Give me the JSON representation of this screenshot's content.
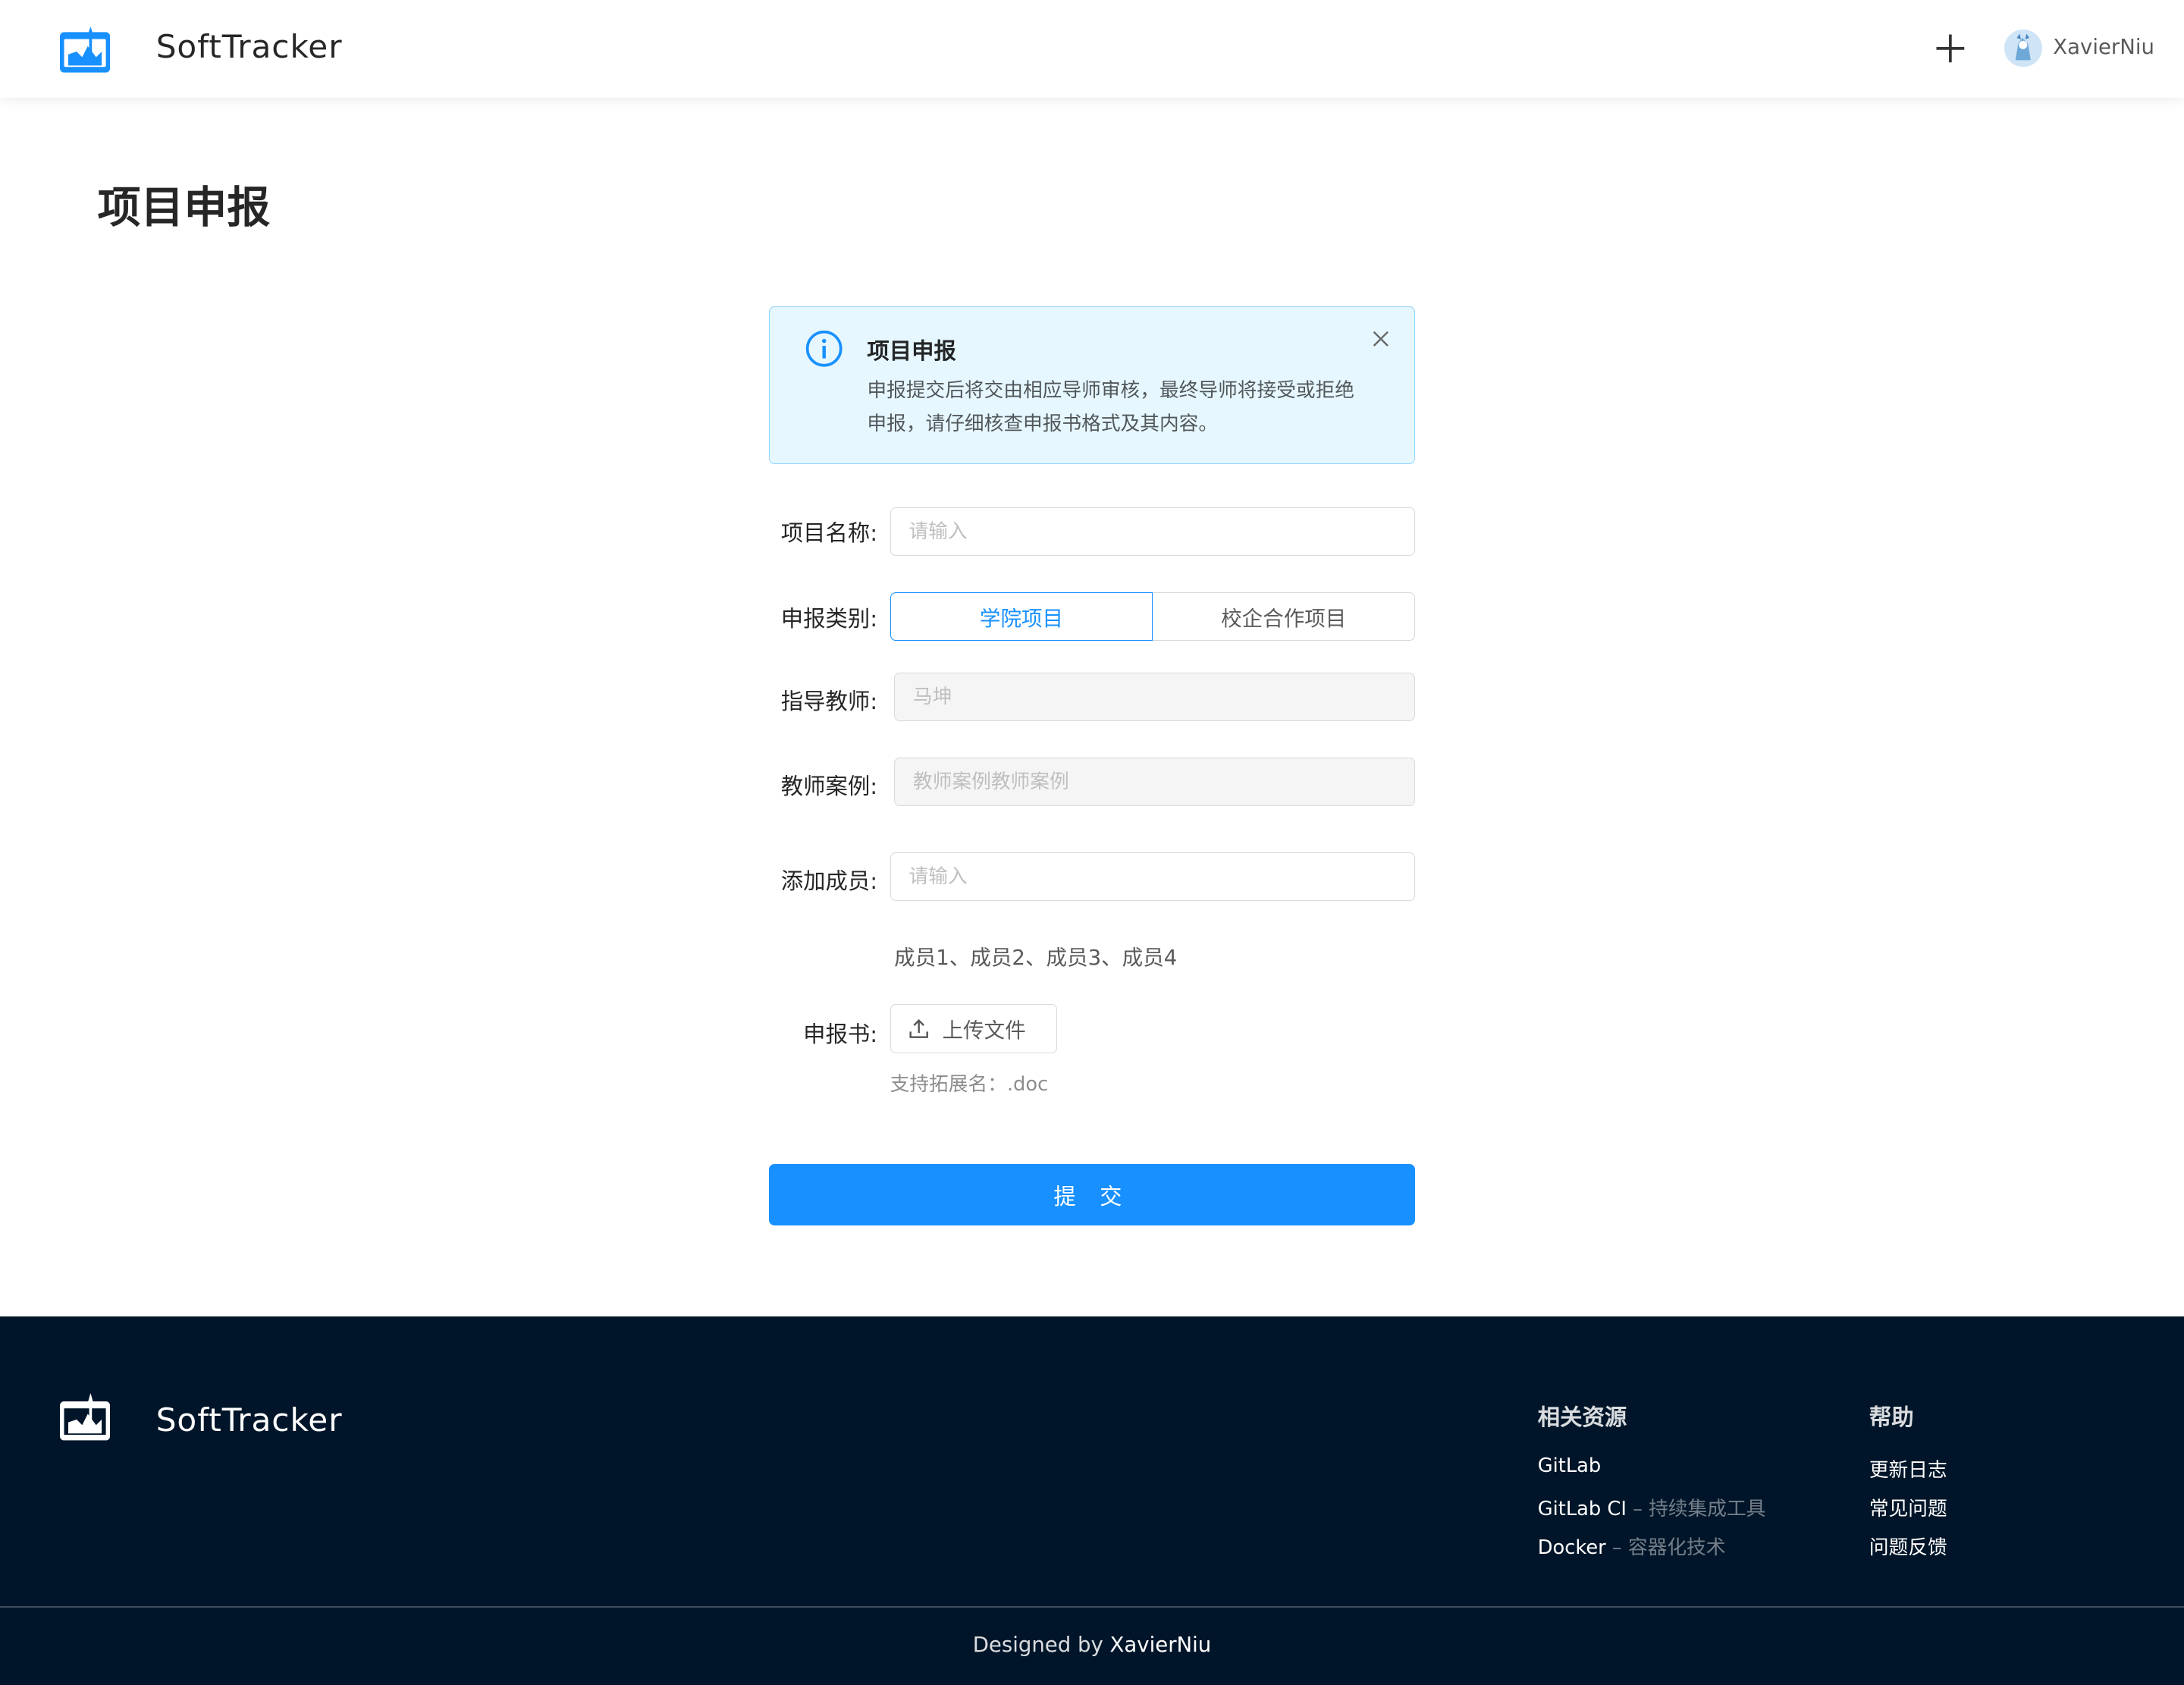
{
  "header": {
    "brand": "SoftTracker",
    "username": "XavierNiu"
  },
  "page": {
    "title": "项目申报"
  },
  "alert": {
    "title": "项目申报",
    "description": "申报提交后将交由相应导师审核，最终导师将接受或拒绝申报，请仔细核查申报书格式及其内容。"
  },
  "form": {
    "project_name": {
      "label": "项目名称:",
      "placeholder": "请输入",
      "value": ""
    },
    "category": {
      "label": "申报类别:",
      "options": [
        "学院项目",
        "校企合作项目"
      ],
      "selected": "学院项目"
    },
    "advisor": {
      "label": "指导教师:",
      "placeholder": "马坤"
    },
    "teacher_case": {
      "label": "教师案例:",
      "placeholder": "教师案例教师案例"
    },
    "add_member": {
      "label": "添加成员:",
      "placeholder": "请输入"
    },
    "members": "成员1、成员2、成员3、成员4",
    "proposal": {
      "label": "申报书:",
      "upload_label": "上传文件",
      "hint": "支持拓展名：.doc"
    },
    "submit_label": "提 交"
  },
  "footer": {
    "brand": "SoftTracker",
    "resources": {
      "title": "相关资源",
      "links": [
        {
          "name": "GitLab",
          "desc": ""
        },
        {
          "name": "GitLab CI",
          "desc": "持续集成工具"
        },
        {
          "name": "Docker",
          "desc": "容器化技术"
        }
      ]
    },
    "help": {
      "title": "帮助",
      "links": [
        "更新日志",
        "常见问题",
        "问题反馈"
      ]
    },
    "designed_by_prefix": "Designed by",
    "designer": "XavierNiu"
  },
  "colors": {
    "primary": "#1890ff",
    "footer_bg": "#001529",
    "alert_bg": "#e6f7ff",
    "alert_border": "#91d5ff"
  }
}
